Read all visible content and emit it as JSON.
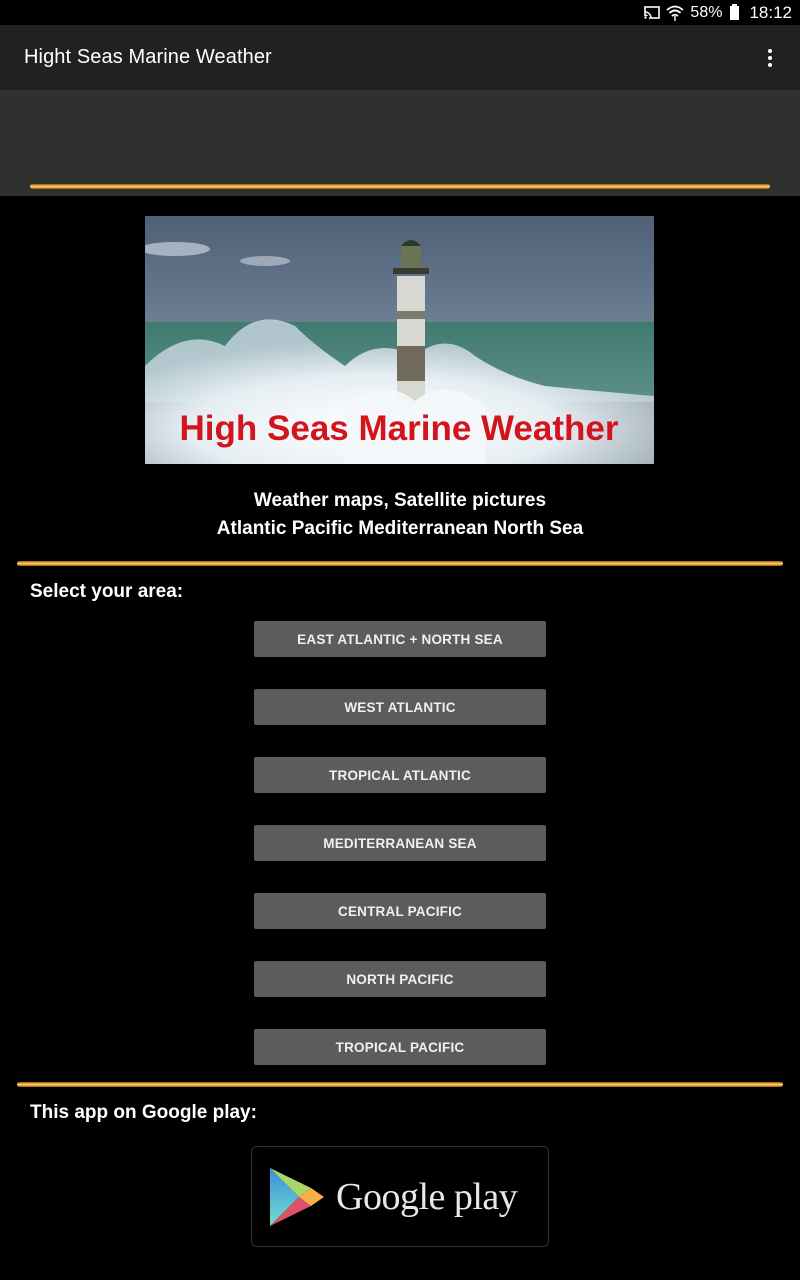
{
  "status_bar": {
    "cast_icon": "cast-icon",
    "wifi_icon": "wifi-icon",
    "battery_percent": "58%",
    "battery_icon": "battery-icon",
    "time": "18:12"
  },
  "app_bar": {
    "title": "Hight Seas Marine Weather",
    "overflow_icon": "more-vert-icon"
  },
  "banner": {
    "caption": "High Seas Marine Weather",
    "description": "lighthouse-in-storm-photo"
  },
  "tagline": {
    "line1": "Weather maps, Satellite pictures",
    "line2": "Atlantic Pacific Mediterranean North Sea"
  },
  "area_section": {
    "label": "Select your area:",
    "buttons": [
      {
        "label": "EAST ATLANTIC + NORTH SEA"
      },
      {
        "label": "WEST ATLANTIC"
      },
      {
        "label": "TROPICAL ATLANTIC"
      },
      {
        "label": "MEDITERRANEAN SEA"
      },
      {
        "label": "CENTRAL PACIFIC"
      },
      {
        "label": "NORTH PACIFIC"
      },
      {
        "label": "TROPICAL PACIFIC"
      }
    ]
  },
  "play_section": {
    "label": "This app on Google play:",
    "badge_text": "Google play",
    "badge_icon": "google-play-icon"
  },
  "colors": {
    "accent_gold": "#f4b23a",
    "button_bg": "#5c5c5e",
    "app_bar_bg": "#212121",
    "banner_text_red": "#d4141c"
  }
}
